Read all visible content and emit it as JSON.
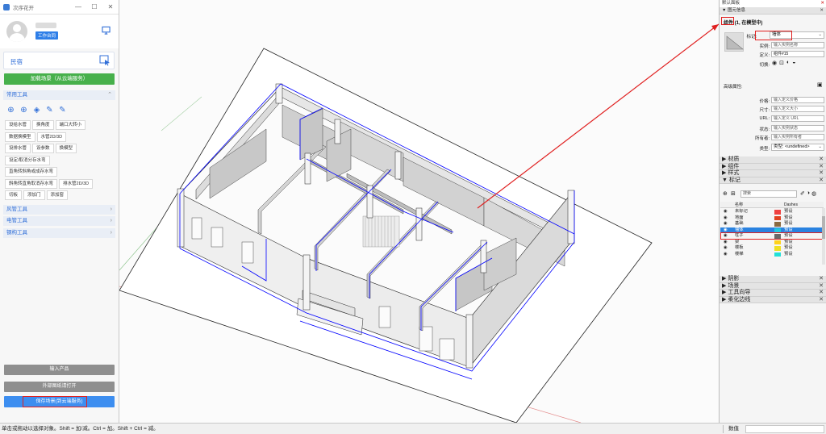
{
  "left_panel": {
    "window_title": "次序花开",
    "window_buttons": [
      "—",
      "☐",
      "✕"
    ],
    "user_badge": "工作台同",
    "project_name": "民宿",
    "load_scene_button": "加载场景（从云端服务）",
    "sections": {
      "common_tools": "常用工具",
      "hvac_tools": "风管工具",
      "electrical_tools": "电管工具",
      "steel_tools": "钢构工具"
    },
    "tool_rows": [
      [
        "设给水管",
        "换角度",
        "端口大转小"
      ],
      [
        "数据换模型",
        "水管2D/3D"
      ],
      [
        "设排水管",
        "设参数",
        "换模型"
      ],
      [
        "设定/取消分存水弯"
      ],
      [
        "直角转斜角或成存水弯"
      ],
      [
        "斜角转直角取消存水弯",
        "排水管2D/3D"
      ],
      [
        "切板",
        "添加门",
        "添加窗"
      ]
    ],
    "import_product_button": "输入产品",
    "open_external_button": "外部图纸请打开",
    "save_scene_button": "保存场景(到云端服务)"
  },
  "tray": {
    "title": "默认面板",
    "sections_top": [
      "▼ 图元信息"
    ],
    "entity_header": "组件 (1, 在模型中)",
    "tag_label": "标记:",
    "tag_value": "墙体",
    "instance_label": "实例:",
    "instance_placeholder": "输入实例名称",
    "definition_label": "定义:",
    "definition_value": "组件#15",
    "toggle_label": "切换:",
    "advanced_label": "高级属性:",
    "price_label": "价格:",
    "price_placeholder": "输入定义价格",
    "size_label": "尺寸:",
    "size_placeholder": "输入定义大小",
    "url_label": "URL:",
    "url_placeholder": "输入定义 URL",
    "status_label": "状态:",
    "status_placeholder": "输入实例状态",
    "owner_label": "所有者:",
    "owner_placeholder": "输入实例所有者",
    "type_label": "类型:",
    "type_value": "类型: <undefined>",
    "collapsed_sections": [
      "▶ 材质",
      "▶ 组件",
      "▶ 样式"
    ],
    "tags_section": "▼ 标记",
    "search_placeholder": "搜索",
    "tags_columns": {
      "name": "名称",
      "dashes": "Dashes"
    },
    "tags": [
      {
        "name": "未标记",
        "color": "#f04040",
        "dash": "预设",
        "selected": false
      },
      {
        "name": "地面",
        "color": "#e04020",
        "dash": "预设",
        "selected": false
      },
      {
        "name": "基础",
        "color": "#8a6a40",
        "dash": "预设",
        "selected": false
      },
      {
        "name": "墙体",
        "color": "#22c8e0",
        "dash": "预设",
        "selected": true
      },
      {
        "name": "柱子",
        "color": "#6a6a6a",
        "dash": "预设",
        "selected": false
      },
      {
        "name": "梁",
        "color": "#ffd21a",
        "dash": "预设",
        "selected": false
      },
      {
        "name": "楼板",
        "color": "#f0e020",
        "dash": "预设",
        "selected": false
      },
      {
        "name": "楼梯",
        "color": "#22e0d8",
        "dash": "预设",
        "selected": false
      }
    ],
    "bottom_sections": [
      "▶ 阴影",
      "▶ 场景",
      "▶ 工具向导",
      "▶ 柔化边线"
    ]
  },
  "statusbar": {
    "message": "单击或拖动以选择对象。Shift = 加/减。Ctrl = 加。Shift + Ctrl = 减。",
    "measurements_label": "数值"
  },
  "icons": {
    "monitor": "monitor-icon",
    "cursor": "cursor-select-icon",
    "eye": "eye-icon",
    "add_tag": "plus-icon",
    "search": "search-icon",
    "details": "details-icon"
  },
  "colors": {
    "accent_blue": "#2f6ed8",
    "green": "#47b04b",
    "save_blue": "#3d8ef0",
    "selected_edge": "#0000ff",
    "annotation_red": "#e02020"
  }
}
